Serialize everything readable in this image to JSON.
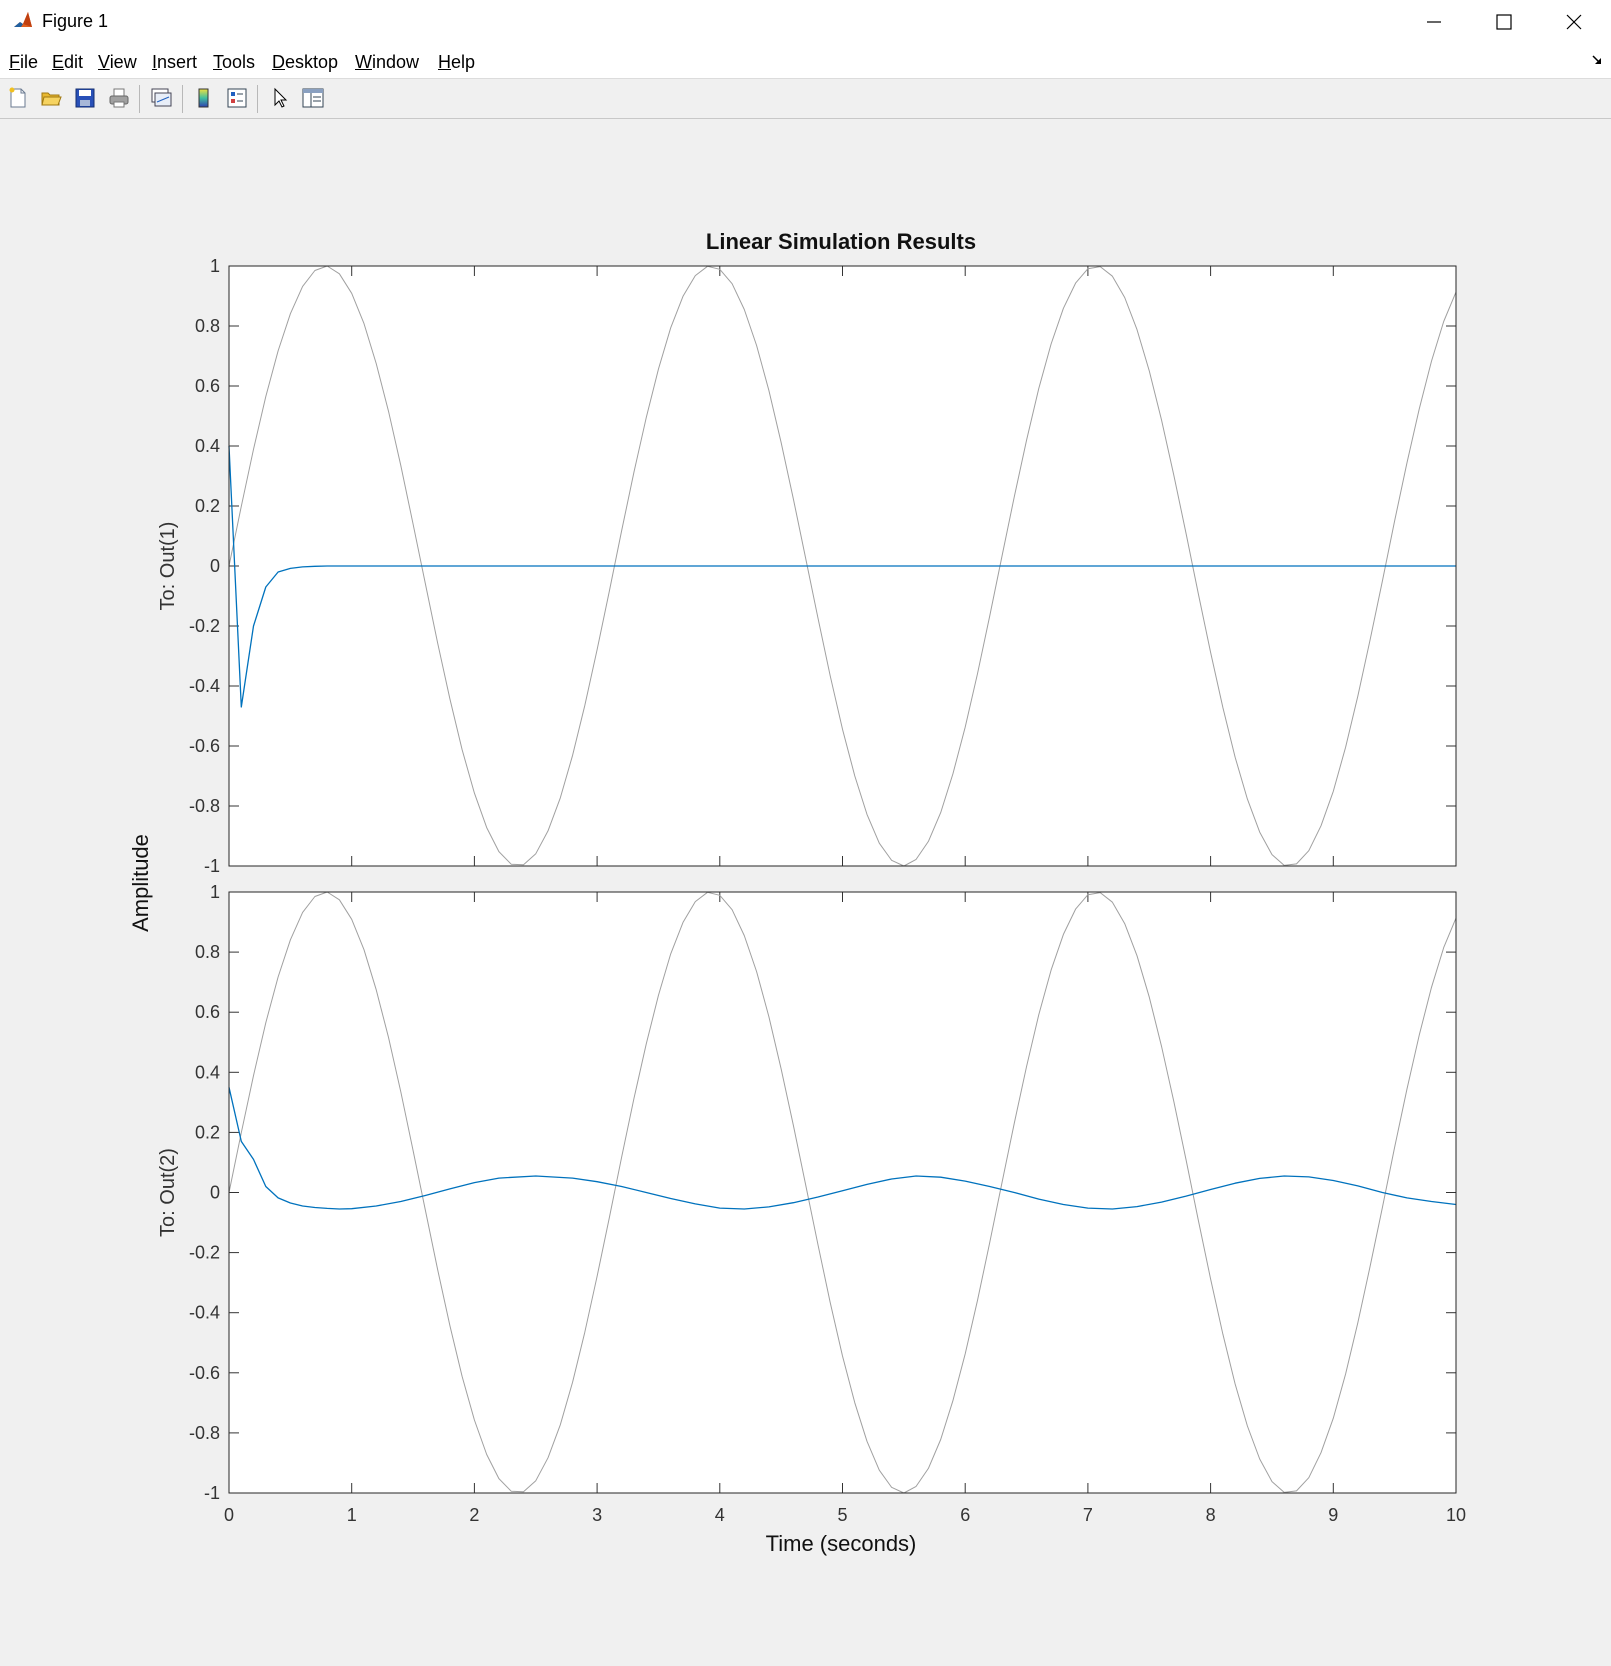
{
  "window": {
    "title": "Figure 1",
    "icons": [
      "matlab-logo-icon",
      "minimize-icon",
      "maximize-icon",
      "close-icon"
    ]
  },
  "menu": {
    "items": [
      "File",
      "Edit",
      "View",
      "Insert",
      "Tools",
      "Desktop",
      "Window",
      "Help"
    ]
  },
  "toolbar": {
    "icons": [
      "new-figure-icon",
      "open-file-icon",
      "save-icon",
      "print-icon",
      "link-plot-icon",
      "colorbar-icon",
      "legend-icon",
      "edit-plot-arrow-icon",
      "property-inspector-icon"
    ]
  },
  "chart_data": {
    "type": "line",
    "title": "Linear Simulation Results",
    "xlabel": "Time (seconds)",
    "ylabel": "Amplitude",
    "xlim": [
      0,
      10
    ],
    "xticks": [
      "0",
      "1",
      "2",
      "3",
      "4",
      "5",
      "6",
      "7",
      "8",
      "9",
      "10"
    ],
    "yticks": [
      "1",
      "0.8",
      "0.6",
      "0.4",
      "0.2",
      "0",
      "-0.2",
      "-0.4",
      "-0.6",
      "-0.8",
      "-1"
    ],
    "grid": false,
    "colors": {
      "input": "#a0a0a0",
      "response": "#0072bd"
    },
    "subplots": [
      {
        "ylabel": "To: Out(1)",
        "ylim": [
          -1,
          1
        ],
        "series": [
          {
            "role": "input",
            "x": [
              0,
              0.1,
              0.2,
              0.3,
              0.4,
              0.5,
              0.6,
              0.7,
              0.8,
              0.9,
              1.0,
              1.1,
              1.2,
              1.3,
              1.4,
              1.5,
              1.6,
              1.7,
              1.8,
              1.9,
              2.0,
              2.1,
              2.2,
              2.3,
              2.4,
              2.5,
              2.6,
              2.7,
              2.8,
              2.9,
              3.0,
              3.1,
              3.2,
              3.3,
              3.4,
              3.5,
              3.6,
              3.7,
              3.8,
              3.9,
              4.0,
              4.1,
              4.2,
              4.3,
              4.4,
              4.5,
              4.6,
              4.7,
              4.8,
              4.9,
              5.0,
              5.1,
              5.2,
              5.3,
              5.4,
              5.5,
              5.6,
              5.7,
              5.8,
              5.9,
              6.0,
              6.1,
              6.2,
              6.3,
              6.4,
              6.5,
              6.6,
              6.7,
              6.8,
              6.9,
              7.0,
              7.1,
              7.2,
              7.3,
              7.4,
              7.5,
              7.6,
              7.7,
              7.8,
              7.9,
              8.0,
              8.1,
              8.2,
              8.3,
              8.4,
              8.5,
              8.6,
              8.7,
              8.8,
              8.9,
              9.0,
              9.1,
              9.2,
              9.3,
              9.4,
              9.5,
              9.6,
              9.7,
              9.8,
              9.9,
              10.0
            ],
            "y": [
              0.0,
              0.199,
              0.389,
              0.565,
              0.717,
              0.841,
              0.932,
              0.985,
              1.0,
              0.974,
              0.909,
              0.808,
              0.675,
              0.516,
              0.335,
              0.141,
              -0.058,
              -0.256,
              -0.443,
              -0.612,
              -0.757,
              -0.872,
              -0.952,
              -0.994,
              -0.996,
              -0.959,
              -0.883,
              -0.773,
              -0.631,
              -0.465,
              -0.279,
              -0.083,
              0.117,
              0.312,
              0.494,
              0.657,
              0.794,
              0.899,
              0.968,
              0.999,
              0.989,
              0.941,
              0.855,
              0.735,
              0.585,
              0.412,
              0.223,
              0.025,
              -0.174,
              -0.366,
              -0.544,
              -0.7,
              -0.828,
              -0.924,
              -0.981,
              -1.0,
              -0.978,
              -0.918,
              -0.822,
              -0.693,
              -0.537,
              -0.359,
              -0.167,
              0.033,
              0.231,
              0.42,
              0.592,
              0.74,
              0.859,
              0.943,
              0.991,
              0.998,
              0.966,
              0.895,
              0.788,
              0.65,
              0.487,
              0.303,
              0.108,
              -0.092,
              -0.288,
              -0.472,
              -0.637,
              -0.777,
              -0.887,
              -0.962,
              -0.998,
              -0.993,
              -0.949,
              -0.866,
              -0.751,
              -0.604,
              -0.434,
              -0.246,
              -0.05,
              0.15,
              0.343,
              0.523,
              0.683,
              0.815,
              0.913
            ]
          },
          {
            "role": "response",
            "x": [
              0,
              0.1,
              0.2,
              0.3,
              0.4,
              0.5,
              0.6,
              0.7,
              0.8,
              1.0,
              2.0,
              3.0,
              4.0,
              5.0,
              6.0,
              7.0,
              8.0,
              9.0,
              10.0
            ],
            "y": [
              0.4,
              -0.47,
              -0.2,
              -0.07,
              -0.02,
              -0.008,
              -0.003,
              -0.001,
              0.0,
              0.0,
              0.0,
              0.0,
              0.0,
              0.0,
              0.0,
              0.0,
              0.0,
              0.0,
              0.0
            ]
          }
        ]
      },
      {
        "ylabel": "To: Out(2)",
        "ylim": [
          -1,
          1
        ],
        "series": [
          {
            "role": "input",
            "same_as": "subplot1-input"
          },
          {
            "role": "response",
            "x": [
              0,
              0.1,
              0.2,
              0.3,
              0.4,
              0.5,
              0.6,
              0.7,
              0.8,
              0.9,
              1.0,
              1.2,
              1.4,
              1.6,
              1.8,
              2.0,
              2.2,
              2.5,
              2.8,
              3.0,
              3.2,
              3.4,
              3.6,
              3.8,
              4.0,
              4.2,
              4.4,
              4.6,
              4.8,
              5.0,
              5.2,
              5.4,
              5.6,
              5.8,
              6.0,
              6.2,
              6.4,
              6.6,
              6.8,
              7.0,
              7.2,
              7.4,
              7.6,
              7.8,
              8.0,
              8.2,
              8.4,
              8.6,
              8.8,
              9.0,
              9.2,
              9.4,
              9.6,
              9.8,
              10.0
            ],
            "y": [
              0.35,
              0.17,
              0.11,
              0.02,
              -0.018,
              -0.035,
              -0.045,
              -0.05,
              -0.053,
              -0.055,
              -0.054,
              -0.045,
              -0.03,
              -0.01,
              0.012,
              0.033,
              0.048,
              0.055,
              0.048,
              0.036,
              0.02,
              0.0,
              -0.02,
              -0.038,
              -0.052,
              -0.055,
              -0.048,
              -0.034,
              -0.015,
              0.006,
              0.027,
              0.045,
              0.055,
              0.051,
              0.038,
              0.02,
              0.0,
              -0.022,
              -0.04,
              -0.052,
              -0.055,
              -0.047,
              -0.032,
              -0.012,
              0.01,
              0.031,
              0.047,
              0.055,
              0.052,
              0.04,
              0.022,
              0.0,
              -0.018,
              -0.03,
              -0.04
            ]
          }
        ]
      }
    ]
  }
}
